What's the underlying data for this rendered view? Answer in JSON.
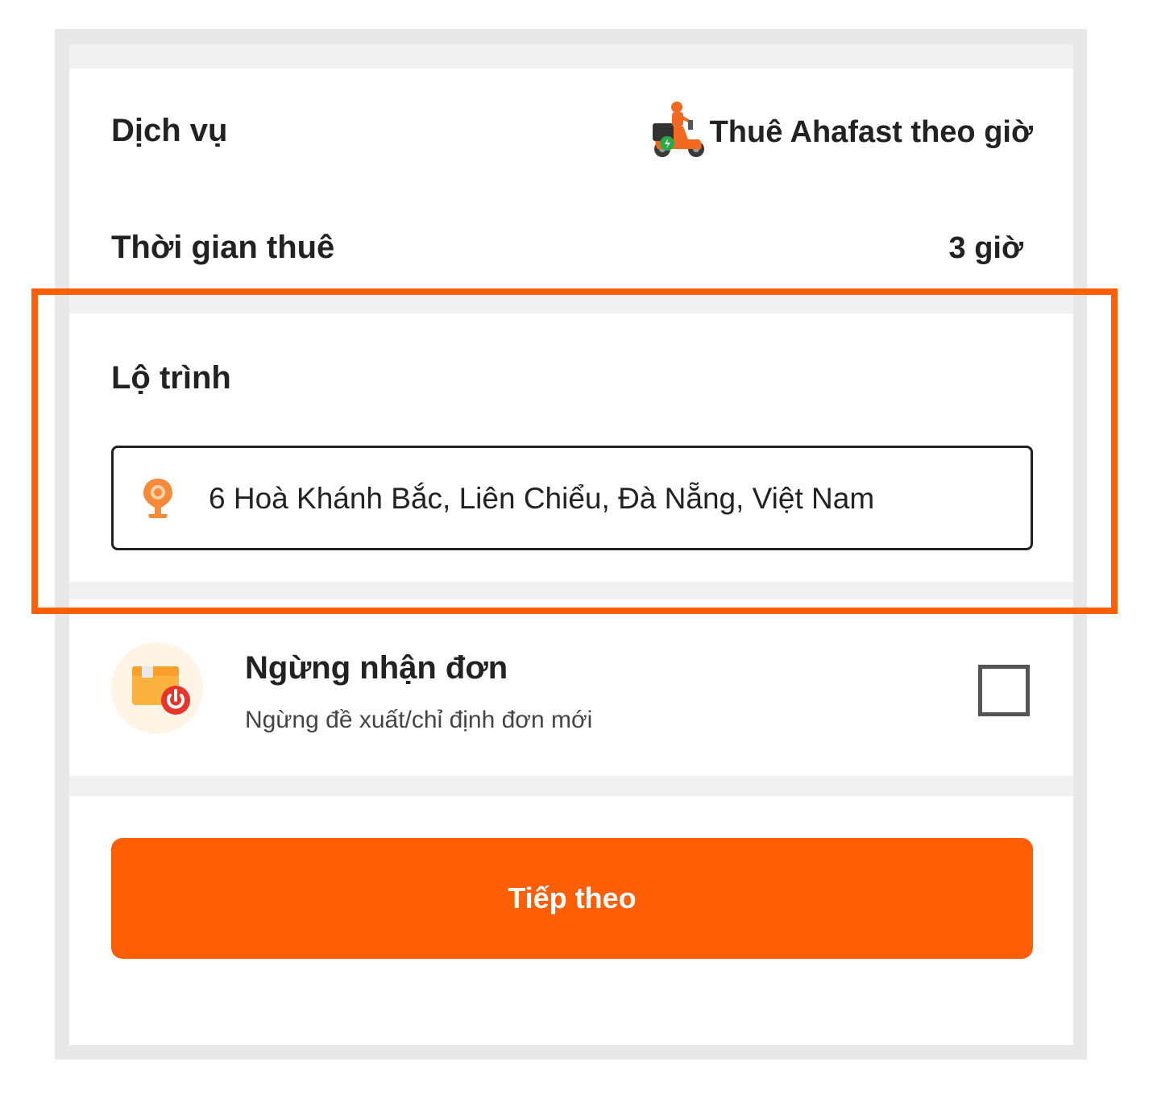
{
  "service": {
    "label": "Dịch vụ",
    "value": "Thuê Ahafast theo giờ",
    "icon": "scooter-rider-icon"
  },
  "rental_time": {
    "label": "Thời gian thuê",
    "value": "3 giờ"
  },
  "route": {
    "title": "Lộ trình",
    "address": "6 Hoà Khánh Bắc, Liên Chiểu, Đà Nẵng, Việt Nam",
    "icon": "location-pin-icon"
  },
  "stop_orders": {
    "title": "Ngừng nhận đơn",
    "subtitle": "Ngừng đề xuất/chỉ định đơn mới",
    "checked": false,
    "icon": "box-power-icon"
  },
  "next_button": {
    "label": "Tiếp theo"
  },
  "colors": {
    "accent": "#fe5f06",
    "frame": "#e8e8e8",
    "separator": "#f0f0f0"
  }
}
